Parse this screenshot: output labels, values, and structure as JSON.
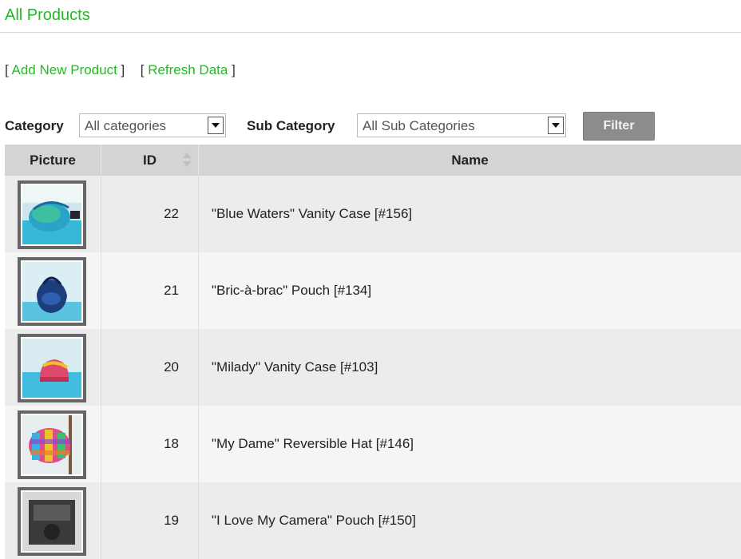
{
  "page": {
    "title": "All Products"
  },
  "actions": {
    "add_new_product": "Add New Product",
    "refresh_data": "Refresh Data"
  },
  "filters": {
    "category_label": "Category",
    "category_value": "All categories",
    "subcategory_label": "Sub Category",
    "subcategory_value": "All Sub Categories",
    "filter_button": "Filter"
  },
  "table": {
    "columns": [
      "Picture",
      "ID",
      "Name"
    ],
    "rows": [
      {
        "id": "22",
        "name": "\"Blue Waters\" Vanity Case [#156]",
        "thumb_icon": "blue-vanity-case-photo"
      },
      {
        "id": "21",
        "name": "\"Bric-à-brac\" Pouch [#134]",
        "thumb_icon": "blue-pouch-photo"
      },
      {
        "id": "20",
        "name": "\"Milady\" Vanity Case [#103]",
        "thumb_icon": "pink-vanity-case-photo"
      },
      {
        "id": "18",
        "name": "\"My Dame\" Reversible Hat [#146]",
        "thumb_icon": "plaid-hat-photo"
      },
      {
        "id": "19",
        "name": "\"I Love My Camera\" Pouch [#150]",
        "thumb_icon": "camera-pouch-photo"
      }
    ]
  },
  "colors": {
    "accent_green": "#22bb22",
    "header_bg": "#d4d4d4",
    "button_bg": "#8c8c8c"
  }
}
